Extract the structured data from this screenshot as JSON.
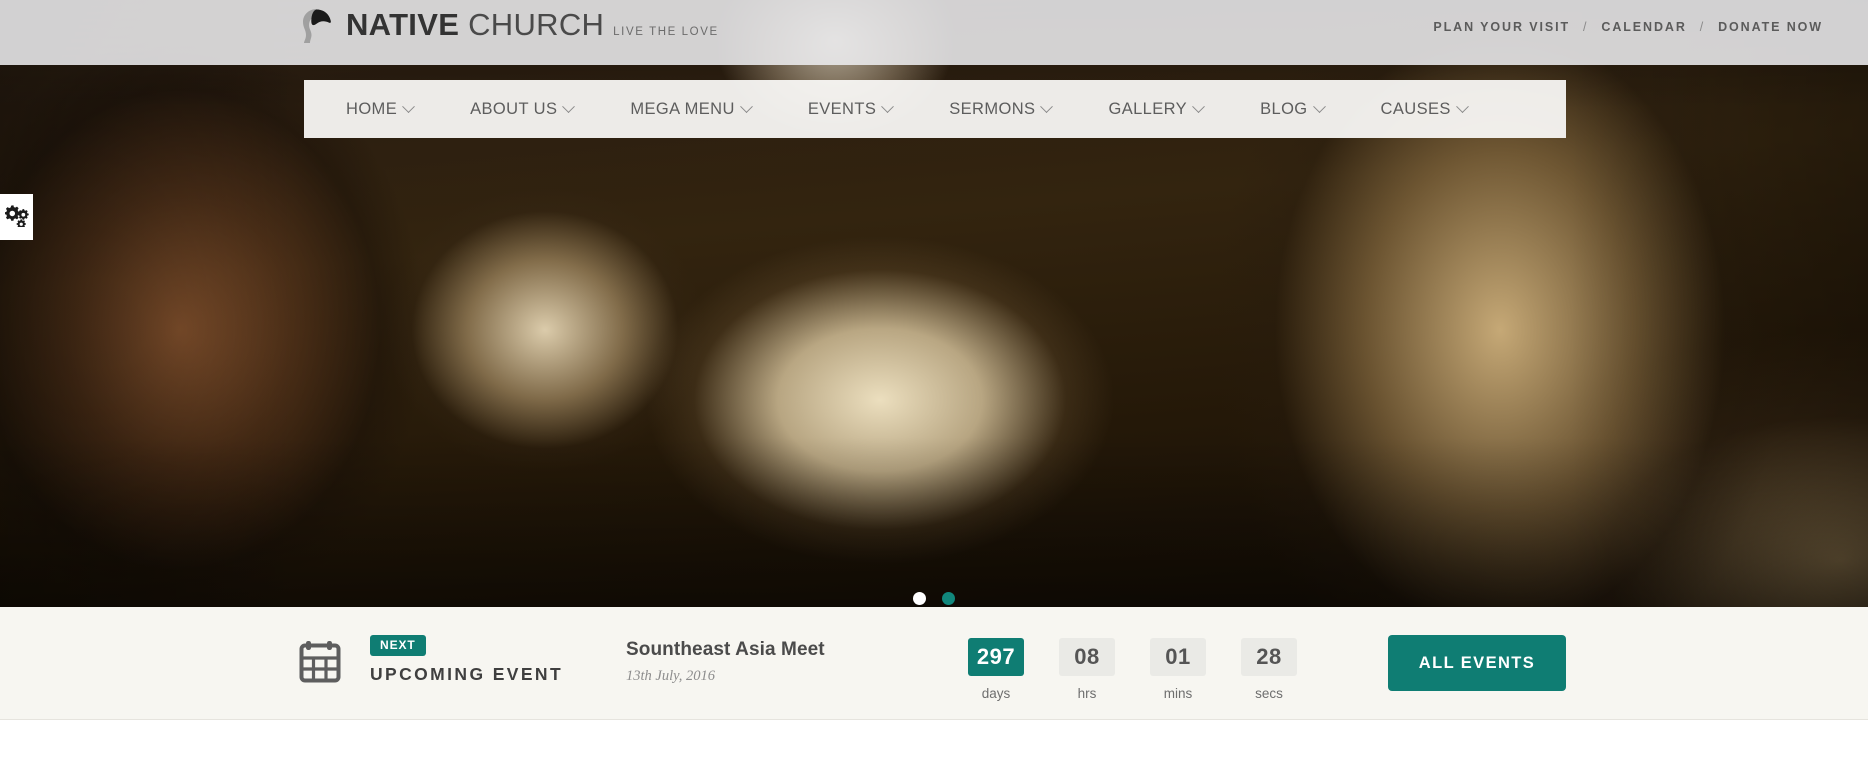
{
  "site": {
    "logo": {
      "icon": "leaf-logo-icon",
      "name_bold": "NATIVE",
      "name_light": "CHURCH",
      "tagline": "LIVE THE LOVE"
    },
    "top_links": [
      {
        "label": "PLAN YOUR VISIT"
      },
      {
        "label": "CALENDAR"
      },
      {
        "label": "DONATE NOW"
      }
    ],
    "top_link_separator": "/"
  },
  "nav": {
    "items": [
      {
        "label": "HOME",
        "has_dropdown": true
      },
      {
        "label": "ABOUT US",
        "has_dropdown": true
      },
      {
        "label": "MEGA MENU",
        "has_dropdown": true
      },
      {
        "label": "EVENTS",
        "has_dropdown": true
      },
      {
        "label": "SERMONS",
        "has_dropdown": true
      },
      {
        "label": "GALLERY",
        "has_dropdown": true
      },
      {
        "label": "BLOG",
        "has_dropdown": true
      },
      {
        "label": "CAUSES",
        "has_dropdown": true
      }
    ]
  },
  "side_widget": {
    "icon": "gears-settings-icon"
  },
  "slider": {
    "dots": [
      {
        "active": false
      },
      {
        "active": true
      }
    ]
  },
  "event_bar": {
    "calendar_icon": "calendar-icon",
    "badge": "NEXT",
    "heading": "UPCOMING EVENT",
    "event_title": "Sountheast Asia Meet",
    "event_date": "13th July, 2016",
    "countdown": [
      {
        "value": "297",
        "label": "days",
        "highlight": true
      },
      {
        "value": "08",
        "label": "hrs",
        "highlight": false
      },
      {
        "value": "01",
        "label": "mins",
        "highlight": false
      },
      {
        "value": "28",
        "label": "secs",
        "highlight": false
      }
    ],
    "all_events_label": "ALL EVENTS"
  },
  "colors": {
    "accent_teal": "#0f7d73",
    "dot_active": "#11877c",
    "event_bar_bg": "#f7f6f1",
    "nav_bg": "#f8f7f4",
    "topbar_bg": "#ececee",
    "text_dark": "#3f3f3f",
    "text_muted": "#8d8d8d"
  }
}
